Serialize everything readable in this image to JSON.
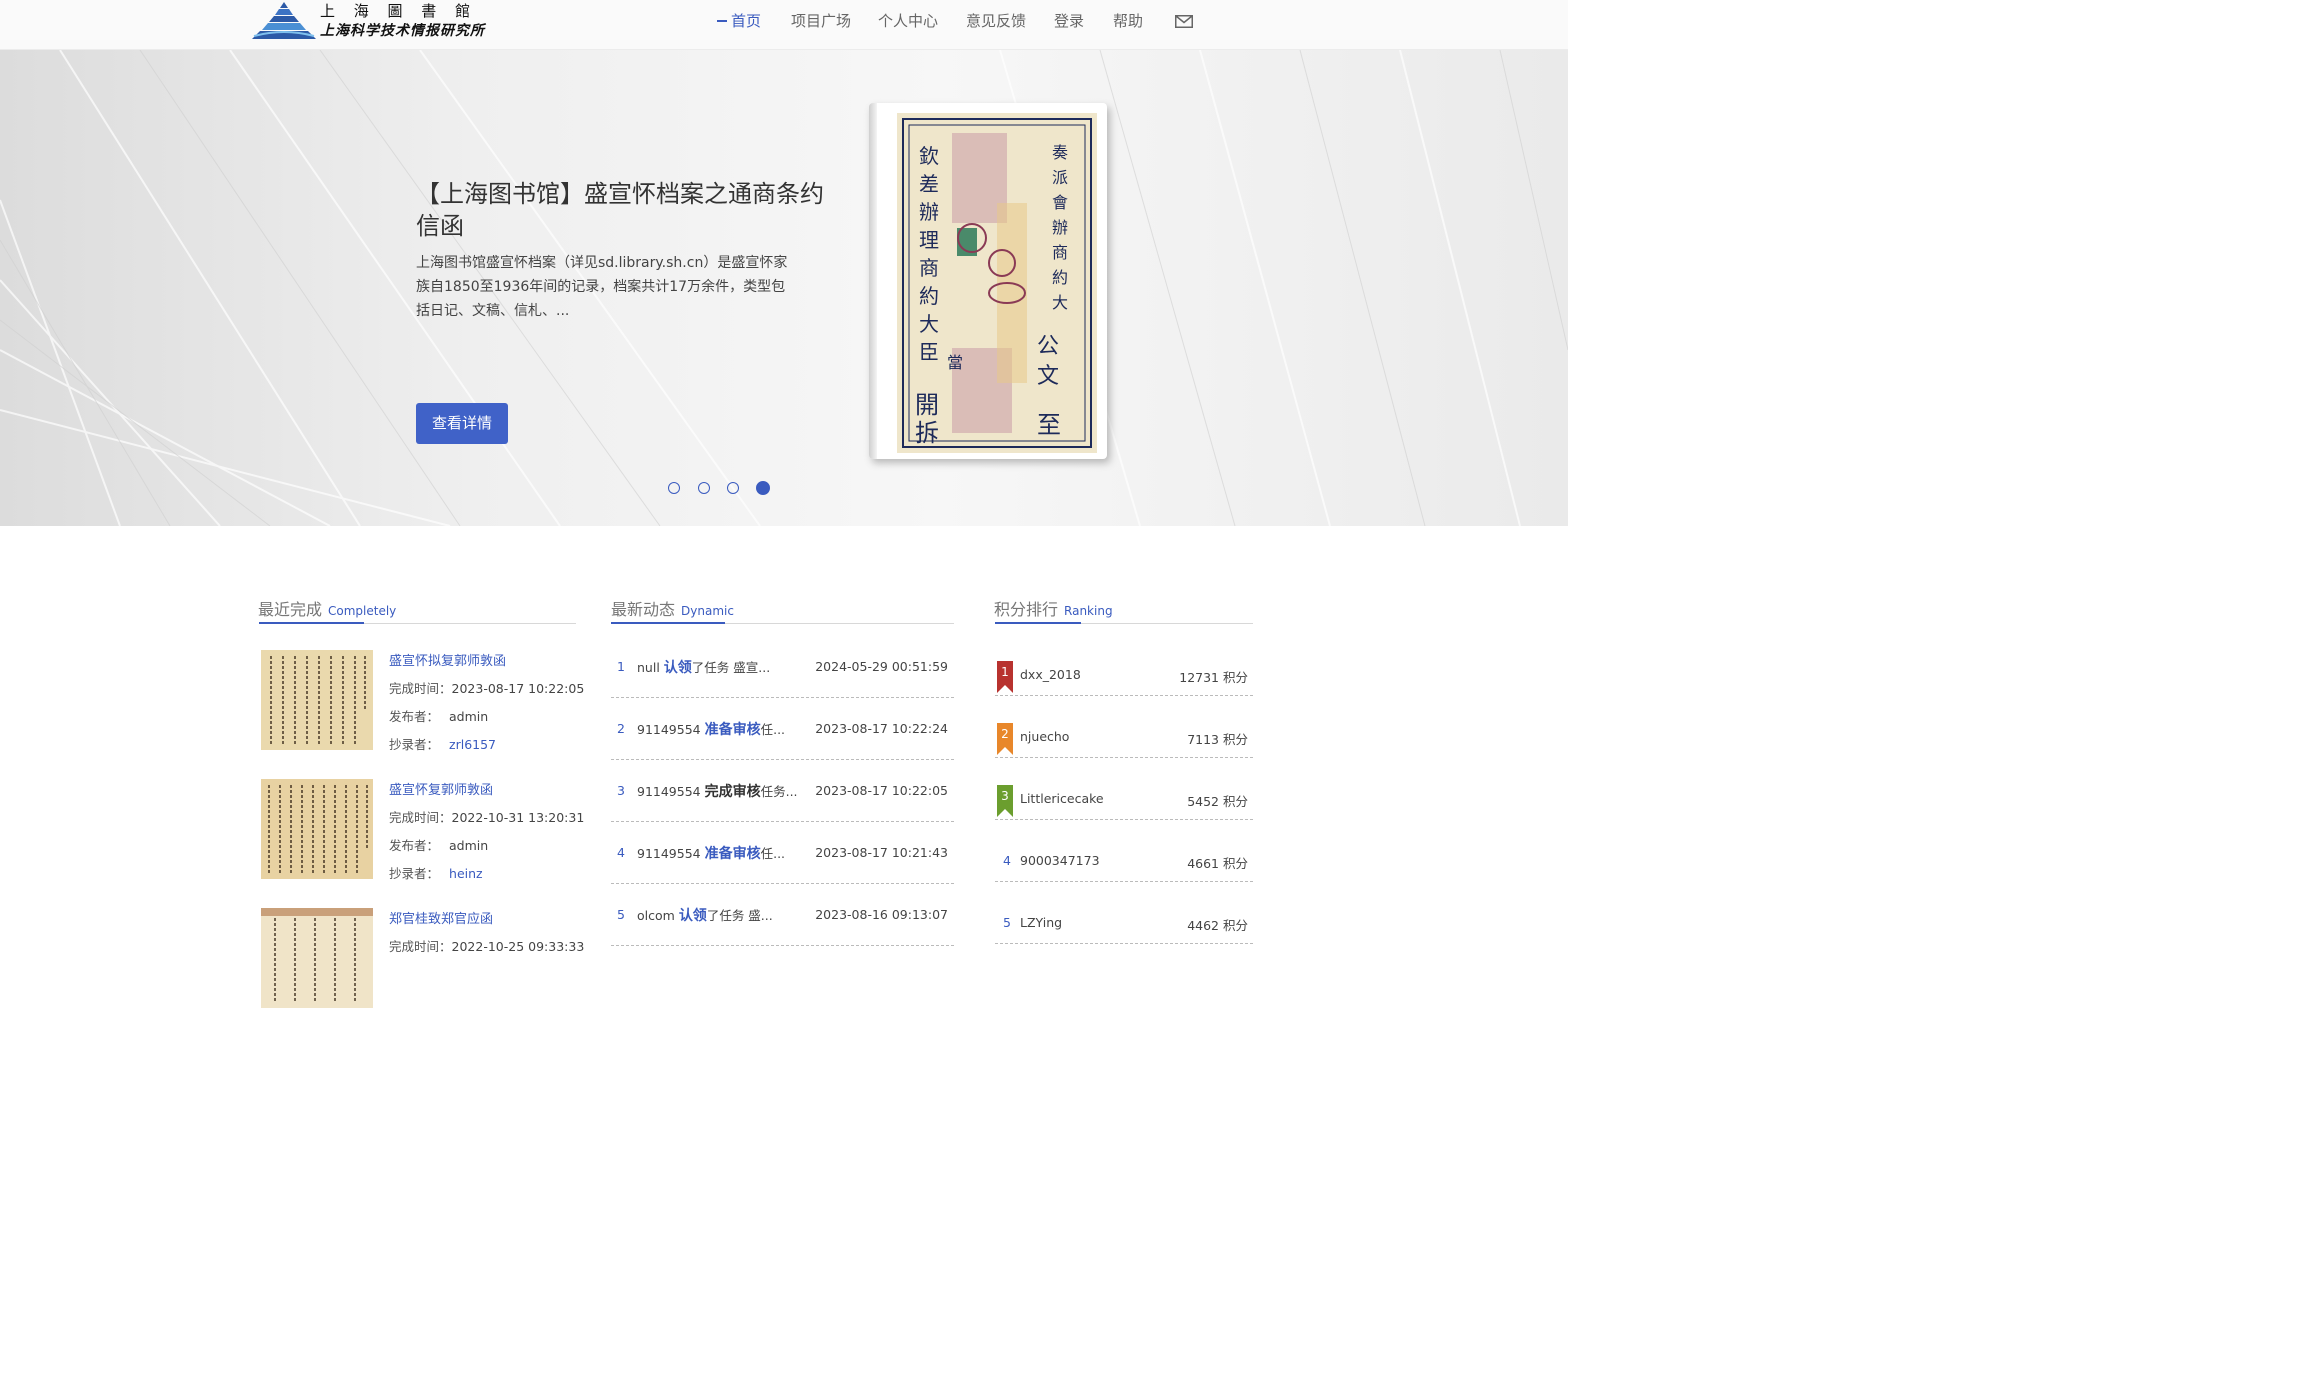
{
  "header": {
    "logo_line1": "上 海 圖 書 館",
    "logo_line2": "上海科学技术情报研究所",
    "nav": [
      "首页",
      "项目广场",
      "个人中心",
      "意见反馈",
      "登录",
      "帮助"
    ]
  },
  "banner": {
    "title": "【上海图书馆】盛宣怀档案之通商条约信函",
    "description": "上海图书馆盛宣怀档案（详见sd.library.sh.cn）是盛宣怀家族自1850至1936年间的记录，档案共计17万余件，类型包括日记、文稿、信札、...",
    "button": "查看详情",
    "active_slide": 4,
    "slide_count": 4
  },
  "completed": {
    "title": "最近完成",
    "subtitle": "Completely",
    "labels": {
      "time": "完成时间：",
      "publisher": "发布者：",
      "transcriber": "抄录者："
    },
    "items": [
      {
        "title": "盛宣怀拟复郭师敦函",
        "time": "2023-08-17 10:22:05",
        "publisher": "admin",
        "transcriber": "zrl6157"
      },
      {
        "title": "盛宣怀复郭师敦函",
        "time": "2022-10-31 13:20:31",
        "publisher": "admin",
        "transcriber": "heinz"
      },
      {
        "title": "郑官桂致郑官应函",
        "time": "2022-10-25 09:33:33",
        "publisher": "",
        "transcriber": ""
      }
    ]
  },
  "dynamic": {
    "title": "最新动态",
    "subtitle": "Dynamic",
    "items": [
      {
        "num": "1",
        "user": "null",
        "action": "认领",
        "rest": "了任务 盛宣...",
        "time": "2024-05-29 00:51:59"
      },
      {
        "num": "2",
        "user": "91149554",
        "action": "准备审核",
        "rest": "任...",
        "time": "2023-08-17 10:22:24"
      },
      {
        "num": "3",
        "user": "91149554",
        "action": "完成审核",
        "rest": "任务...",
        "time": "2023-08-17 10:22:05"
      },
      {
        "num": "4",
        "user": "91149554",
        "action": "准备审核",
        "rest": "任...",
        "time": "2023-08-17 10:21:43"
      },
      {
        "num": "5",
        "user": "olcom",
        "action": "认领",
        "rest": "了任务 盛...",
        "time": "2023-08-16 09:13:07"
      }
    ]
  },
  "ranking": {
    "title": "积分排行",
    "subtitle": "Ranking",
    "items": [
      {
        "rank": "1",
        "name": "dxx_2018",
        "score": "12731 积分",
        "color": "#b8322f"
      },
      {
        "rank": "2",
        "name": "njuecho",
        "score": "7113 积分",
        "color": "#e8872a"
      },
      {
        "rank": "3",
        "name": "Littlericecake",
        "score": "5452 积分",
        "color": "#6b9e2e"
      },
      {
        "rank": "4",
        "name": "9000347173",
        "score": "4661 积分",
        "color": ""
      },
      {
        "rank": "5",
        "name": "LZYing",
        "score": "4462 积分",
        "color": ""
      }
    ]
  },
  "colors": {
    "accent": "#3a5bbf",
    "button": "#4062c8"
  }
}
